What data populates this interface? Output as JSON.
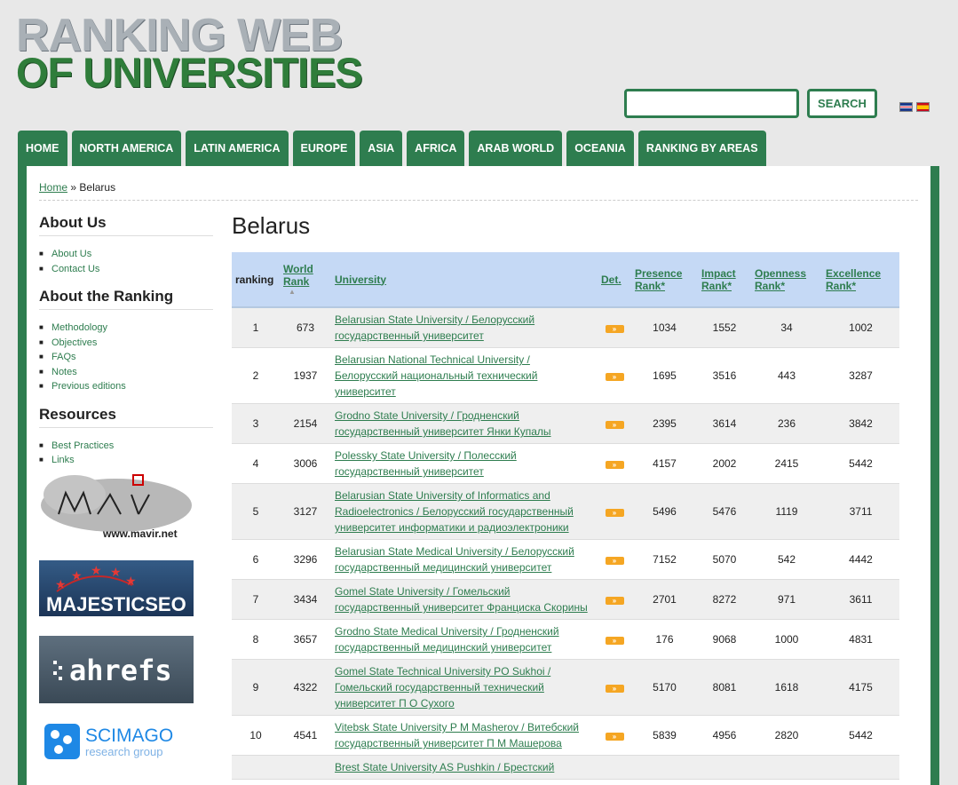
{
  "logo": {
    "line1": "RANKING WEB",
    "line2": "OF UNIVERSITIES"
  },
  "search": {
    "placeholder": "",
    "button_label": "SEARCH"
  },
  "languages": [
    "English",
    "Español"
  ],
  "nav": [
    "HOME",
    "NORTH AMERICA",
    "LATIN AMERICA",
    "EUROPE",
    "ASIA",
    "AFRICA",
    "ARAB WORLD",
    "OCEANIA",
    "RANKING BY AREAS"
  ],
  "breadcrumb": {
    "home": "Home",
    "separator": "»",
    "current": "Belarus"
  },
  "sidebar": {
    "about_us": {
      "title": "About Us",
      "items": [
        "About Us",
        "Contact Us"
      ]
    },
    "about_ranking": {
      "title": "About the Ranking",
      "items": [
        "Methodology",
        "Objectives",
        "FAQs",
        "Notes",
        "Previous editions"
      ]
    },
    "resources": {
      "title": "Resources",
      "items": [
        "Best Practices",
        "Links"
      ]
    },
    "banners": {
      "mavir": "www.mavir.net",
      "majestic": "MAJESTICSEO",
      "ahrefs": "ahrefs",
      "scimago_1": "SCIMAGO",
      "scimago_2": "research group"
    }
  },
  "page_title": "Belarus",
  "table": {
    "headers": {
      "ranking": "ranking",
      "world_rank_1": "World",
      "world_rank_2": "Rank",
      "university": "University",
      "det": "Det.",
      "presence_1": "Presence",
      "presence_2": "Rank*",
      "impact_1": "Impact",
      "impact_2": "Rank*",
      "openness_1": "Openness",
      "openness_2": "Rank*",
      "excellence_1": "Excellence",
      "excellence_2": "Rank*"
    },
    "det_label": "»",
    "rows": [
      {
        "ranking": "1",
        "world": "673",
        "university": "Belarusian State University / Белорусский государственный университет",
        "presence": "1034",
        "impact": "1552",
        "openness": "34",
        "excellence": "1002"
      },
      {
        "ranking": "2",
        "world": "1937",
        "university": "Belarusian National Technical University / Белорусский национальный технический университет",
        "presence": "1695",
        "impact": "3516",
        "openness": "443",
        "excellence": "3287"
      },
      {
        "ranking": "3",
        "world": "2154",
        "university": "Grodno State University / Гродненский государственный университет Янки Купалы",
        "presence": "2395",
        "impact": "3614",
        "openness": "236",
        "excellence": "3842"
      },
      {
        "ranking": "4",
        "world": "3006",
        "university": "Polessky State University / Полесский государственный университет",
        "presence": "4157",
        "impact": "2002",
        "openness": "2415",
        "excellence": "5442"
      },
      {
        "ranking": "5",
        "world": "3127",
        "university": "Belarusian State University of Informatics and Radioelectronics / Белорусский государственный университет информатики и радиоэлектроники",
        "presence": "5496",
        "impact": "5476",
        "openness": "1119",
        "excellence": "3711"
      },
      {
        "ranking": "6",
        "world": "3296",
        "university": "Belarusian State Medical University / Белорусский государственный медицинский университет",
        "presence": "7152",
        "impact": "5070",
        "openness": "542",
        "excellence": "4442"
      },
      {
        "ranking": "7",
        "world": "3434",
        "university": "Gomel State University / Гомельский государственный университет Франциска Скорины",
        "presence": "2701",
        "impact": "8272",
        "openness": "971",
        "excellence": "3611"
      },
      {
        "ranking": "8",
        "world": "3657",
        "university": "Grodno State Medical University / Гродненский государственный медицинский университет",
        "presence": "176",
        "impact": "9068",
        "openness": "1000",
        "excellence": "4831"
      },
      {
        "ranking": "9",
        "world": "4322",
        "university": "Gomel State Technical University PO Sukhoi / Гомельский государственный технический университет П О Сухого",
        "presence": "5170",
        "impact": "8081",
        "openness": "1618",
        "excellence": "4175"
      },
      {
        "ranking": "10",
        "world": "4541",
        "university": "Vitebsk State University P M Masherov / Витебский государственный университет П М Машерова",
        "presence": "5839",
        "impact": "4956",
        "openness": "2820",
        "excellence": "5442"
      },
      {
        "ranking": "",
        "world": "",
        "university": "Brest State University AS Pushkin / Брестский",
        "presence": "",
        "impact": "",
        "openness": "",
        "excellence": ""
      }
    ]
  }
}
